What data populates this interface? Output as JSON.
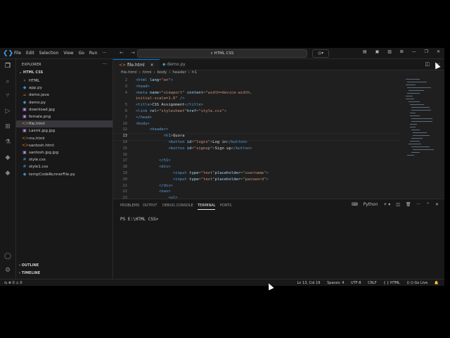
{
  "titlebar": {
    "menu": [
      "File",
      "Edit",
      "Selection",
      "View",
      "Go",
      "Run",
      "···"
    ],
    "search": "HTML CSS",
    "nav_back": "←",
    "nav_forward": "→"
  },
  "sidebar": {
    "title": "EXPLORER",
    "more": "···",
    "folder": "⌄ HTML CSS",
    "items": [
      {
        "label": "HTML",
        "icon": "›",
        "color": "#cccccc"
      },
      {
        "label": "app.py",
        "icon": "◆",
        "color": "#3a8fd6"
      },
      {
        "label": "demo.java",
        "icon": "☕",
        "color": "#e06c4b"
      },
      {
        "label": "demo.py",
        "icon": "◆",
        "color": "#3a8fd6"
      },
      {
        "label": "download.jpg",
        "icon": "▣",
        "color": "#b58ae0"
      },
      {
        "label": "female.png",
        "icon": "▣",
        "color": "#b58ae0"
      },
      {
        "label": "file.html",
        "icon": "<>",
        "color": "#e37933"
      },
      {
        "label": "Laxmi.jpg.jpg",
        "icon": "▣",
        "color": "#b58ae0"
      },
      {
        "label": "ms.html",
        "icon": "<>",
        "color": "#e37933"
      },
      {
        "label": "santosh.html",
        "icon": "<>",
        "color": "#e37933"
      },
      {
        "label": "santosh.jpg.jpg",
        "icon": "▣",
        "color": "#b58ae0"
      },
      {
        "label": "style.css",
        "icon": "#",
        "color": "#3a8fd6"
      },
      {
        "label": "style1.css",
        "icon": "#",
        "color": "#3a8fd6"
      },
      {
        "label": "tempCodeRunnerFile.py",
        "icon": "◆",
        "color": "#3a8fd6"
      }
    ],
    "selected_index": 6,
    "outline": "›  OUTLINE",
    "timeline": "›  TIMELINE"
  },
  "tabs": [
    {
      "label": "file.html",
      "icon": "<>",
      "active": true
    },
    {
      "label": "demo.py",
      "icon": "◆",
      "active": false
    }
  ],
  "breadcrumb": [
    "file.html",
    "›",
    "html",
    "›",
    "body",
    "›",
    "header",
    "›",
    "h1"
  ],
  "code": [
    {
      "n": "2",
      "tokens": [
        [
          "tag",
          "<html "
        ],
        [
          "attr",
          "lang"
        ],
        [
          "br",
          "="
        ],
        [
          "str",
          "\"en\""
        ],
        [
          "tag",
          ">"
        ]
      ],
      "indent": 0
    },
    {
      "n": "3",
      "tokens": [
        [
          "tag",
          "<head>"
        ]
      ],
      "indent": 0
    },
    {
      "n": "4",
      "tokens": [
        [
          "tag",
          "<meta "
        ],
        [
          "attr",
          "name"
        ],
        [
          "br",
          "="
        ],
        [
          "str",
          "\"viewport\" "
        ],
        [
          "attr",
          "content"
        ],
        [
          "br",
          "="
        ],
        [
          "str",
          "\"width=device-width,"
        ]
      ],
      "indent": 0
    },
    {
      "n": "",
      "tokens": [
        [
          "str",
          "initial-scale=1.0\" "
        ],
        [
          "tag",
          "/>"
        ]
      ],
      "indent": 0
    },
    {
      "n": "5",
      "tokens": [
        [
          "tag",
          "<title>"
        ],
        [
          "txt",
          "CSS Assignment"
        ],
        [
          "tag",
          "</title>"
        ]
      ],
      "indent": 0
    },
    {
      "n": "6",
      "tokens": [
        [
          "tag",
          "<link "
        ],
        [
          "attr",
          "rel"
        ],
        [
          "br",
          "="
        ],
        [
          "str",
          "\"stylesheet\""
        ],
        [
          "attr",
          "href"
        ],
        [
          "br",
          "="
        ],
        [
          "str",
          "\"style.css\""
        ],
        [
          "tag",
          ">"
        ]
      ],
      "indent": 0
    },
    {
      "n": "7",
      "tokens": [
        [
          "tag",
          "</head>"
        ]
      ],
      "indent": 0
    },
    {
      "n": "10",
      "tokens": [
        [
          "tag",
          "<body>"
        ]
      ],
      "indent": 0
    },
    {
      "n": "12",
      "tokens": [
        [
          "tag",
          "<header>"
        ]
      ],
      "indent": 3
    },
    {
      "n": "13",
      "tokens": [
        [
          "tag",
          "<h1>"
        ],
        [
          "txt",
          "Quora"
        ]
      ],
      "indent": 6
    },
    {
      "n": "14",
      "tokens": [
        [
          "tag",
          "<button "
        ],
        [
          "attr",
          "id"
        ],
        [
          "br",
          "="
        ],
        [
          "str",
          "\"login\""
        ],
        [
          "tag",
          ">"
        ],
        [
          "txt",
          "Log in"
        ],
        [
          "tag",
          "</button>"
        ]
      ],
      "indent": 7
    },
    {
      "n": "15",
      "tokens": [
        [
          "tag",
          "<button "
        ],
        [
          "attr",
          "id"
        ],
        [
          "br",
          "="
        ],
        [
          "str",
          "\"signup\""
        ],
        [
          "tag",
          ">"
        ],
        [
          "txt",
          "Sign up"
        ],
        [
          "tag",
          "</button>"
        ]
      ],
      "indent": 7
    },
    {
      "n": "16",
      "tokens": [],
      "indent": 0
    },
    {
      "n": "17",
      "tokens": [
        [
          "tag",
          "</h1>"
        ]
      ],
      "indent": 5
    },
    {
      "n": "18",
      "tokens": [
        [
          "tag",
          "<div>"
        ]
      ],
      "indent": 5
    },
    {
      "n": "19",
      "tokens": [
        [
          "tag",
          "<input "
        ],
        [
          "attr",
          "type"
        ],
        [
          "br",
          "="
        ],
        [
          "str",
          "\"text\""
        ],
        [
          "attr",
          "placeholder"
        ],
        [
          "br",
          "="
        ],
        [
          "str",
          "\"username\""
        ],
        [
          "tag",
          ">"
        ]
      ],
      "indent": 8
    },
    {
      "n": "20",
      "tokens": [
        [
          "tag",
          "<input "
        ],
        [
          "attr",
          "type"
        ],
        [
          "br",
          "="
        ],
        [
          "str",
          "\"text\""
        ],
        [
          "attr",
          "placeholder"
        ],
        [
          "br",
          "="
        ],
        [
          "str",
          "\"password\""
        ],
        [
          "tag",
          ">"
        ]
      ],
      "indent": 8
    },
    {
      "n": "21",
      "tokens": [
        [
          "tag",
          "</div>"
        ]
      ],
      "indent": 5
    },
    {
      "n": "22",
      "tokens": [
        [
          "tag",
          "<nav>"
        ]
      ],
      "indent": 5
    },
    {
      "n": "23",
      "tokens": [
        [
          "tag",
          "<ul>"
        ]
      ],
      "indent": 7
    }
  ],
  "current_line": "13",
  "panel": {
    "tabs": [
      "PROBLEMS",
      "OUTPUT",
      "DEBUG CONSOLE",
      "TERMINAL",
      "PORTS"
    ],
    "active_tab": "TERMINAL",
    "terminal_kind": "Python",
    "prompt": "PS E:\\HTML CSS>"
  },
  "status": {
    "remote": "⇆",
    "errors": "⊗ 0",
    "warnings": "⚠ 0",
    "position": "Ln 13, Col 19",
    "spaces": "Spaces: 4",
    "encoding": "UTF-8",
    "eol": "CRLF",
    "language": "{ } HTML",
    "golive": "((·)) Go Live",
    "bell": "🔔"
  }
}
